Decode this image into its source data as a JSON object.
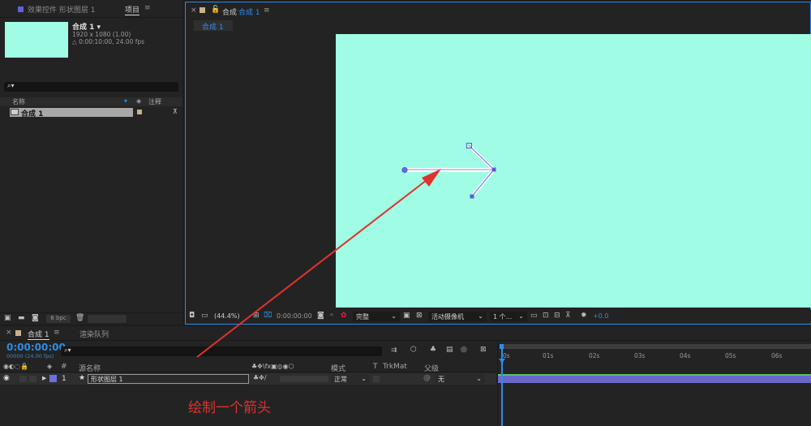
{
  "project_panel": {
    "tab_effects": "效果控件 形状图层 1",
    "tab_project": "项目",
    "comp_name": "合成 1 ▾",
    "comp_size": "1920 x 1080 (1.00)",
    "comp_duration": "△ 0:00:10:00, 24.00 fps",
    "col_name": "名称",
    "col_comment": "注释",
    "item_name": "合成 1",
    "bpc": "8 bpc"
  },
  "viewer": {
    "tab_label": "合成",
    "tab_comp": "合成 1",
    "breadcrumb": "合成 1",
    "zoom": "(44.4%)",
    "timecode": "0:00:00:00",
    "resolution": "完整",
    "camera": "活动摄像机",
    "views": "1 个...",
    "exposure": "+0.0",
    "bg_color": "#a0fce4"
  },
  "timeline": {
    "tab_comp": "合成 1",
    "tab_render": "渲染队列",
    "timecode": "0:00:00:00",
    "frame_info": "00000 (24.00 fps)",
    "col_num": "#",
    "col_source": "源名称",
    "col_mode": "模式",
    "col_t": "T",
    "col_trkmat": "TrkMat",
    "col_parent": "父级",
    "layer_num": "1",
    "layer_name": "形状图层 1",
    "layer_mode": "正常",
    "layer_parent": "无",
    "ruler": [
      "0s",
      "01s",
      "02s",
      "03s",
      "04s",
      "05s",
      "06s"
    ]
  },
  "annotation": {
    "caption": "绘制一个箭头",
    "color": "#e0322e"
  },
  "colors": {
    "accent": "#2d8ceb",
    "layer_label": "#6c6fe0",
    "layer_bar": "#6a68c9"
  }
}
